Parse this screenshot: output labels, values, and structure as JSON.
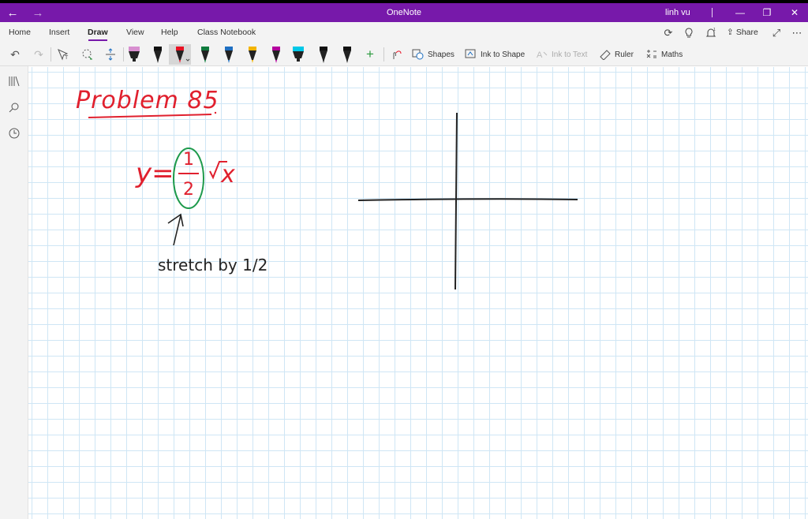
{
  "window": {
    "title": "OneNote",
    "user": "linh vu"
  },
  "menu": {
    "tabs": [
      "Home",
      "Insert",
      "Draw",
      "View",
      "Help",
      "Class Notebook"
    ],
    "active_tab": "Draw",
    "share_label": "Share"
  },
  "toolbar": {
    "shapes_label": "Shapes",
    "ink_to_shape_label": "Ink to Shape",
    "ink_to_text_label": "Ink to Text",
    "ruler_label": "Ruler",
    "maths_label": "Maths",
    "pens": [
      {
        "tip": "#222222",
        "band": "#d88fd0",
        "type": "highlighter"
      },
      {
        "tip": "#111111",
        "band": "#111111",
        "type": "pen"
      },
      {
        "tip": "#e81123",
        "band": "#e81123",
        "type": "pen",
        "selected": true
      },
      {
        "tip": "#0f7b3e",
        "band": "#0f7b3e",
        "type": "pen"
      },
      {
        "tip": "#1e6fc1",
        "band": "#1e6fc1",
        "type": "pen"
      },
      {
        "tip": "#f2b400",
        "band": "#f2b400",
        "type": "pen"
      },
      {
        "tip": "#b4009e",
        "band": "#b4009e",
        "type": "pen"
      },
      {
        "tip": "#00c8e8",
        "band": "#00c8e8",
        "type": "highlighter"
      },
      {
        "tip": "#111111",
        "band": "#111111",
        "type": "pen"
      },
      {
        "tip": "#111111",
        "band": "#111111",
        "type": "pen"
      }
    ]
  },
  "notes": {
    "heading": "Problem 85",
    "equation": "y = (1/2) √x",
    "annotation": "stretch by 1/2"
  },
  "colors": {
    "accent": "#7719aa",
    "ink_red": "#e0202e",
    "ink_green": "#1e9a4c",
    "ink_black": "#222222",
    "grid": "#cfe6f5"
  }
}
